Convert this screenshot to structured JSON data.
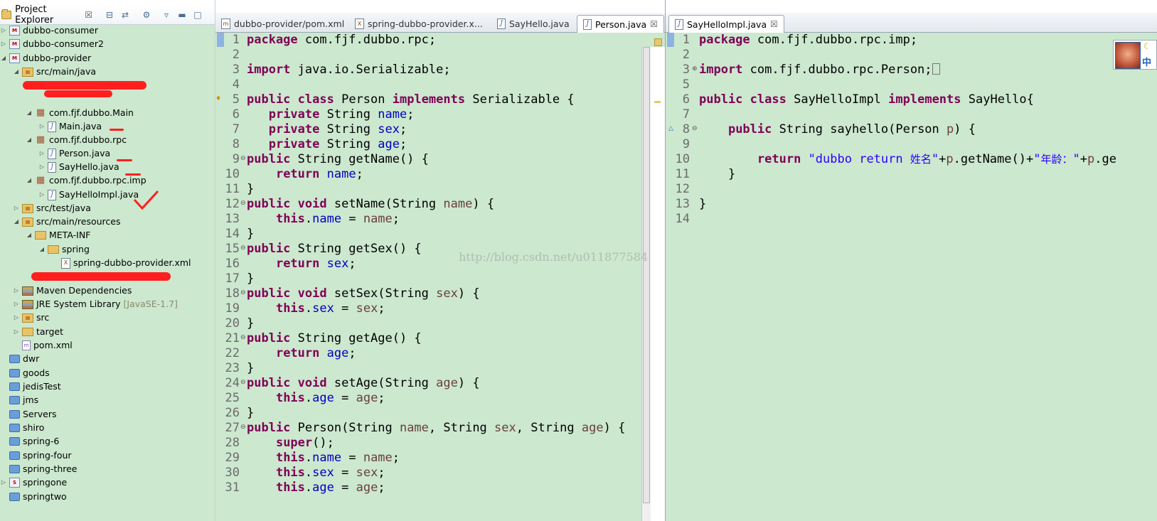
{
  "explorer": {
    "title": "Project Explorer",
    "close": "☒",
    "items": [
      {
        "label": "dubbo-consumer"
      },
      {
        "label": "dubbo-consumer2"
      },
      {
        "label": "dubbo-provider"
      },
      {
        "label": "src/main/java"
      },
      {
        "label": "com.fjf.dubbo.Main"
      },
      {
        "label": "Main.java"
      },
      {
        "label": "com.fjf.dubbo.rpc"
      },
      {
        "label": "Person.java"
      },
      {
        "label": "SayHello.java"
      },
      {
        "label": "com.fjf.dubbo.rpc.imp"
      },
      {
        "label": "SayHelloImpl.java"
      },
      {
        "label": "src/test/java"
      },
      {
        "label": "src/main/resources"
      },
      {
        "label": "META-INF"
      },
      {
        "label": "spring"
      },
      {
        "label": "spring-dubbo-provider.xml"
      },
      {
        "label": "Maven Dependencies"
      },
      {
        "label": "JRE System Library",
        "decoration": "[JavaSE-1.7]"
      },
      {
        "label": "src"
      },
      {
        "label": "target"
      },
      {
        "label": "pom.xml"
      },
      {
        "label": "dwr"
      },
      {
        "label": "goods"
      },
      {
        "label": "jedisTest"
      },
      {
        "label": "jms"
      },
      {
        "label": "Servers"
      },
      {
        "label": "shiro"
      },
      {
        "label": "spring-6"
      },
      {
        "label": "spring-four"
      },
      {
        "label": "spring-three"
      },
      {
        "label": "springone"
      },
      {
        "label": "springtwo"
      }
    ]
  },
  "left_editor": {
    "tabs": [
      {
        "label": "dubbo-provider/pom.xml"
      },
      {
        "label": "spring-dubbo-provider.x..."
      },
      {
        "label": "SayHello.java"
      },
      {
        "label": "Person.java",
        "close": "☒"
      }
    ]
  },
  "right_editor": {
    "tabs": [
      {
        "label": "SayHelloImpl.java",
        "close": "☒"
      }
    ]
  },
  "watermark": "http://blog.csdn.net/u011877584",
  "ime": {
    "mode": "中",
    "moon": "☾"
  },
  "colors": {
    "editor_background": "#cce8cf",
    "keyword": "#7f0055",
    "field": "#0000c0",
    "string": "#2a00ff",
    "redaction": "#ff1f1f"
  }
}
